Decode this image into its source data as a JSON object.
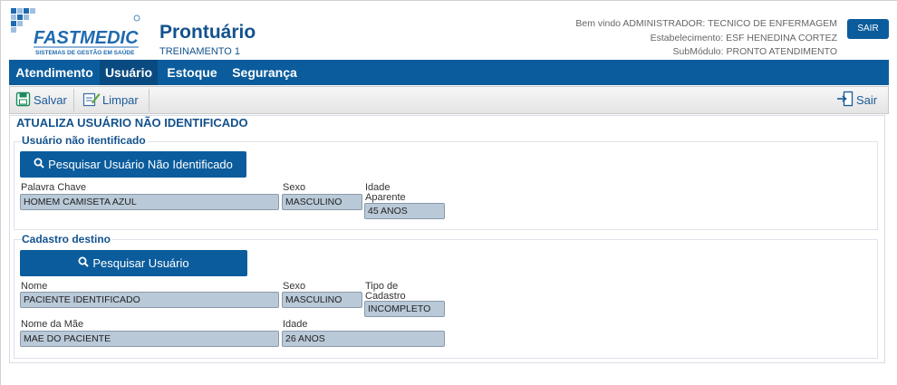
{
  "brand": {
    "logo_text": "FASTMEDIC",
    "logo_tagline": "SISTEMAS DE GESTÃO EM SAÚDE",
    "app_title": "Prontuário",
    "app_subtitle": "TREINAMENTO 1"
  },
  "user_info": {
    "welcome": "Bem vindo ADMINISTRADOR: TECNICO DE ENFERMAGEM",
    "establishment": "Estabelecimento: ESF HENEDINA CORTEZ",
    "submodule": "SubMódulo: PRONTO ATENDIMENTO"
  },
  "header": {
    "logout_label": "SAIR"
  },
  "menu": [
    "Atendimento",
    "Usuário",
    "Estoque",
    "Segurança"
  ],
  "toolbar": {
    "save_label": "Salvar",
    "clear_label": "Limpar",
    "exit_label": "Sair"
  },
  "page": {
    "title": "ATUALIZA USUÁRIO NÃO IDENTIFICADO"
  },
  "unidentified": {
    "legend": "Usuário não itentificado",
    "search_button": "Pesquisar Usuário Não Identificado",
    "keyword_label": "Palavra Chave",
    "keyword_value": "HOMEM CAMISETA AZUL",
    "sex_label": "Sexo",
    "sex_value": "MASCULINO",
    "age_label_line1": "Idade",
    "age_label_line2": "Aparente",
    "age_value": "45 ANOS"
  },
  "destination": {
    "legend": "Cadastro destino",
    "search_button": "Pesquisar Usuário",
    "name_label": "Nome",
    "name_value": "PACIENTE IDENTIFICADO",
    "sex_label": "Sexo",
    "sex_value": "MASCULINO",
    "type_label_line1": "Tipo de",
    "type_label_line2": "Cadastro",
    "type_value": "INCOMPLETO",
    "mother_label": "Nome da Mãe",
    "mother_value": "MAE DO PACIENTE",
    "age_label": "Idade",
    "age_value": "26 ANOS"
  }
}
